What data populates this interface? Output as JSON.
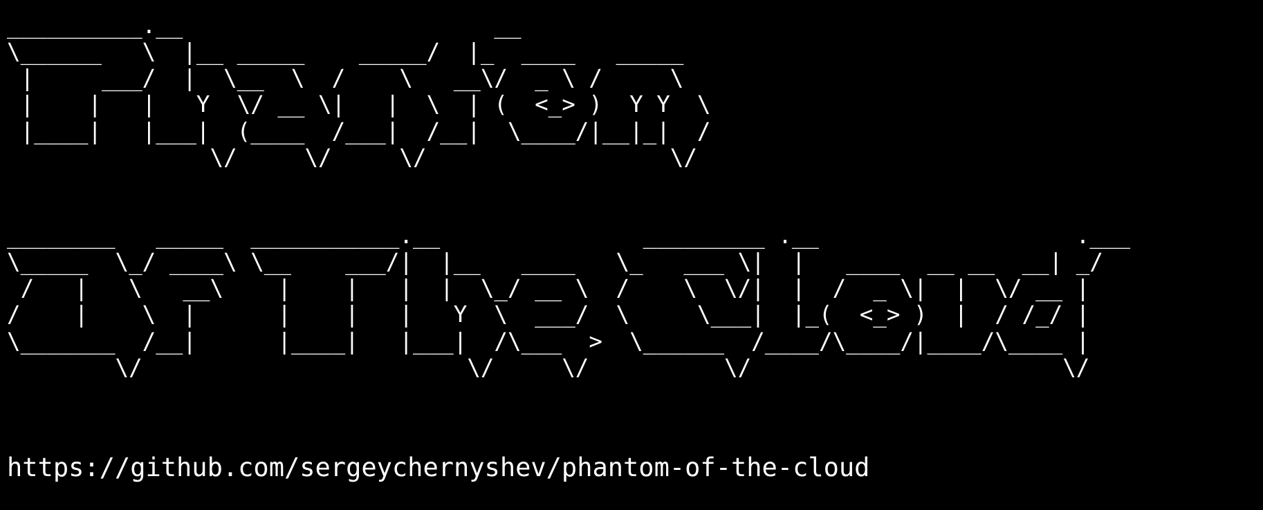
{
  "colors": {
    "background": "#000000",
    "text": "#ffffff"
  },
  "banner": {
    "phantom_block": "__________.__                       __                 \n\\______   \\  |__ _____    _____/  |_  ____   _____  \n |     ___/  |  \\__  \\  /    \\   __\\/  _ \\ /     \\ \n |    |   |   Y  \\/ __ \\|   |  \\  | (  <_> )  Y Y  \\\n |____|   |___|  (____  /___|  /__|  \\____/|__|_|  /\n               \\/     \\/     \\/                  \\/ ",
    "of_the_cloud_block": "________   _____  ___________.__               _________ .__                   .___\n\\_____  \\_/ ____\\ \\__    ___/|  |__   ____   \\_   ___ \\|  |   ____  __ __  __| _/\n /   |   \\   __\\    |    |   |  |  \\_/ __ \\  /    \\  \\/|  |  /  _ \\|  |  \\/ __ | \n/    |    \\  |      |    |   |   Y  \\  ___/  \\     \\___|  |_(  <_> )  |  / /_/ | \n\\_______  /__|      |____|   |___|  /\\___  >  \\______  /____/\\____/|____/\\____ | \n        \\/                        \\/     \\/          \\/                       \\/ "
  },
  "repo_url": "https://github.com/sergeychernyshev/phantom-of-the-cloud"
}
